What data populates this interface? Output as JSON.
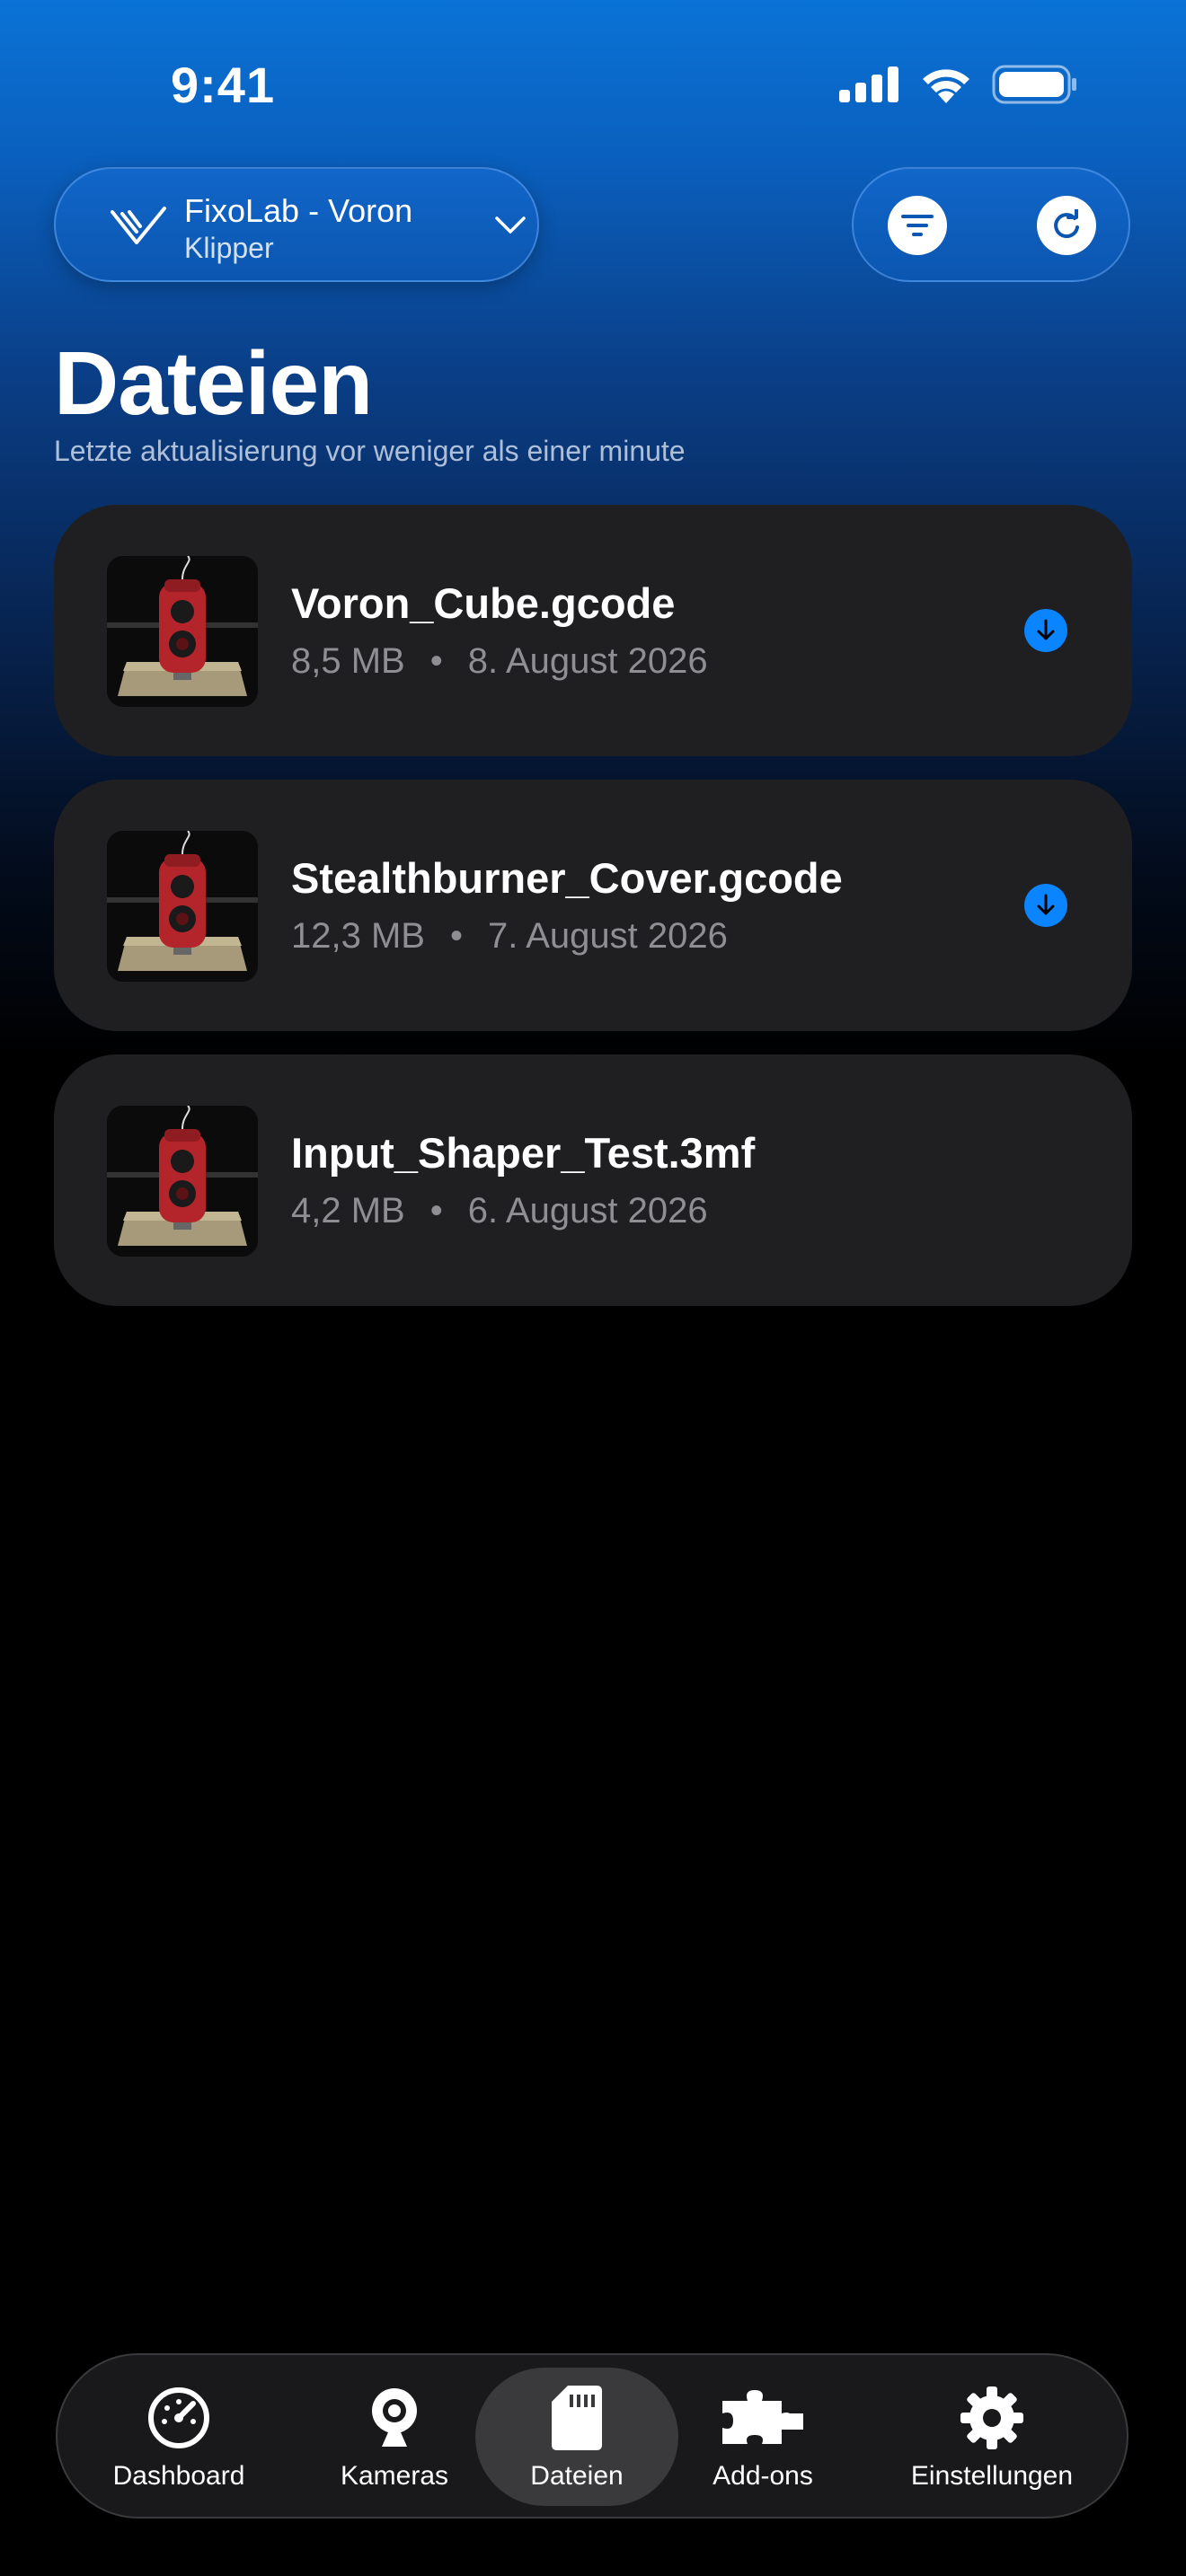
{
  "status_bar": {
    "time": "9:41"
  },
  "printer_selector": {
    "name": "FixoLab - Voron",
    "firmware": "Klipper",
    "logo_icon": "voron-logo-icon",
    "chevron_icon": "chevron-down-icon"
  },
  "header_actions": {
    "filter_icon": "filter-icon",
    "refresh_icon": "refresh-icon"
  },
  "page": {
    "title": "Dateien",
    "subtitle": "Letzte aktualisierung vor weniger als einer minute"
  },
  "files": [
    {
      "name": "Voron_Cube.gcode",
      "size": "8,5 MB",
      "separator": "•",
      "date": "8. August 2026",
      "download_available": true
    },
    {
      "name": "Stealthburner_Cover.gcode",
      "size": "12,3 MB",
      "separator": "•",
      "date": "7. August 2026",
      "download_available": true
    },
    {
      "name": "Input_Shaper_Test.3mf",
      "size": "4,2 MB",
      "separator": "•",
      "date": "6. August 2026",
      "download_available": false
    }
  ],
  "tab_bar": {
    "tabs": [
      {
        "label": "Dashboard",
        "icon": "speedometer-icon",
        "active": false
      },
      {
        "label": "Kameras",
        "icon": "webcam-icon",
        "active": false
      },
      {
        "label": "Dateien",
        "icon": "sd-card-icon",
        "active": true
      },
      {
        "label": "Add-ons",
        "icon": "puzzle-piece-icon",
        "active": false
      },
      {
        "label": "Einstellungen",
        "icon": "gear-icon",
        "active": false
      }
    ]
  },
  "colors": {
    "accent": "#0a84ff",
    "card_background": "#1f1f22",
    "secondary_text": "#8e8e93"
  }
}
